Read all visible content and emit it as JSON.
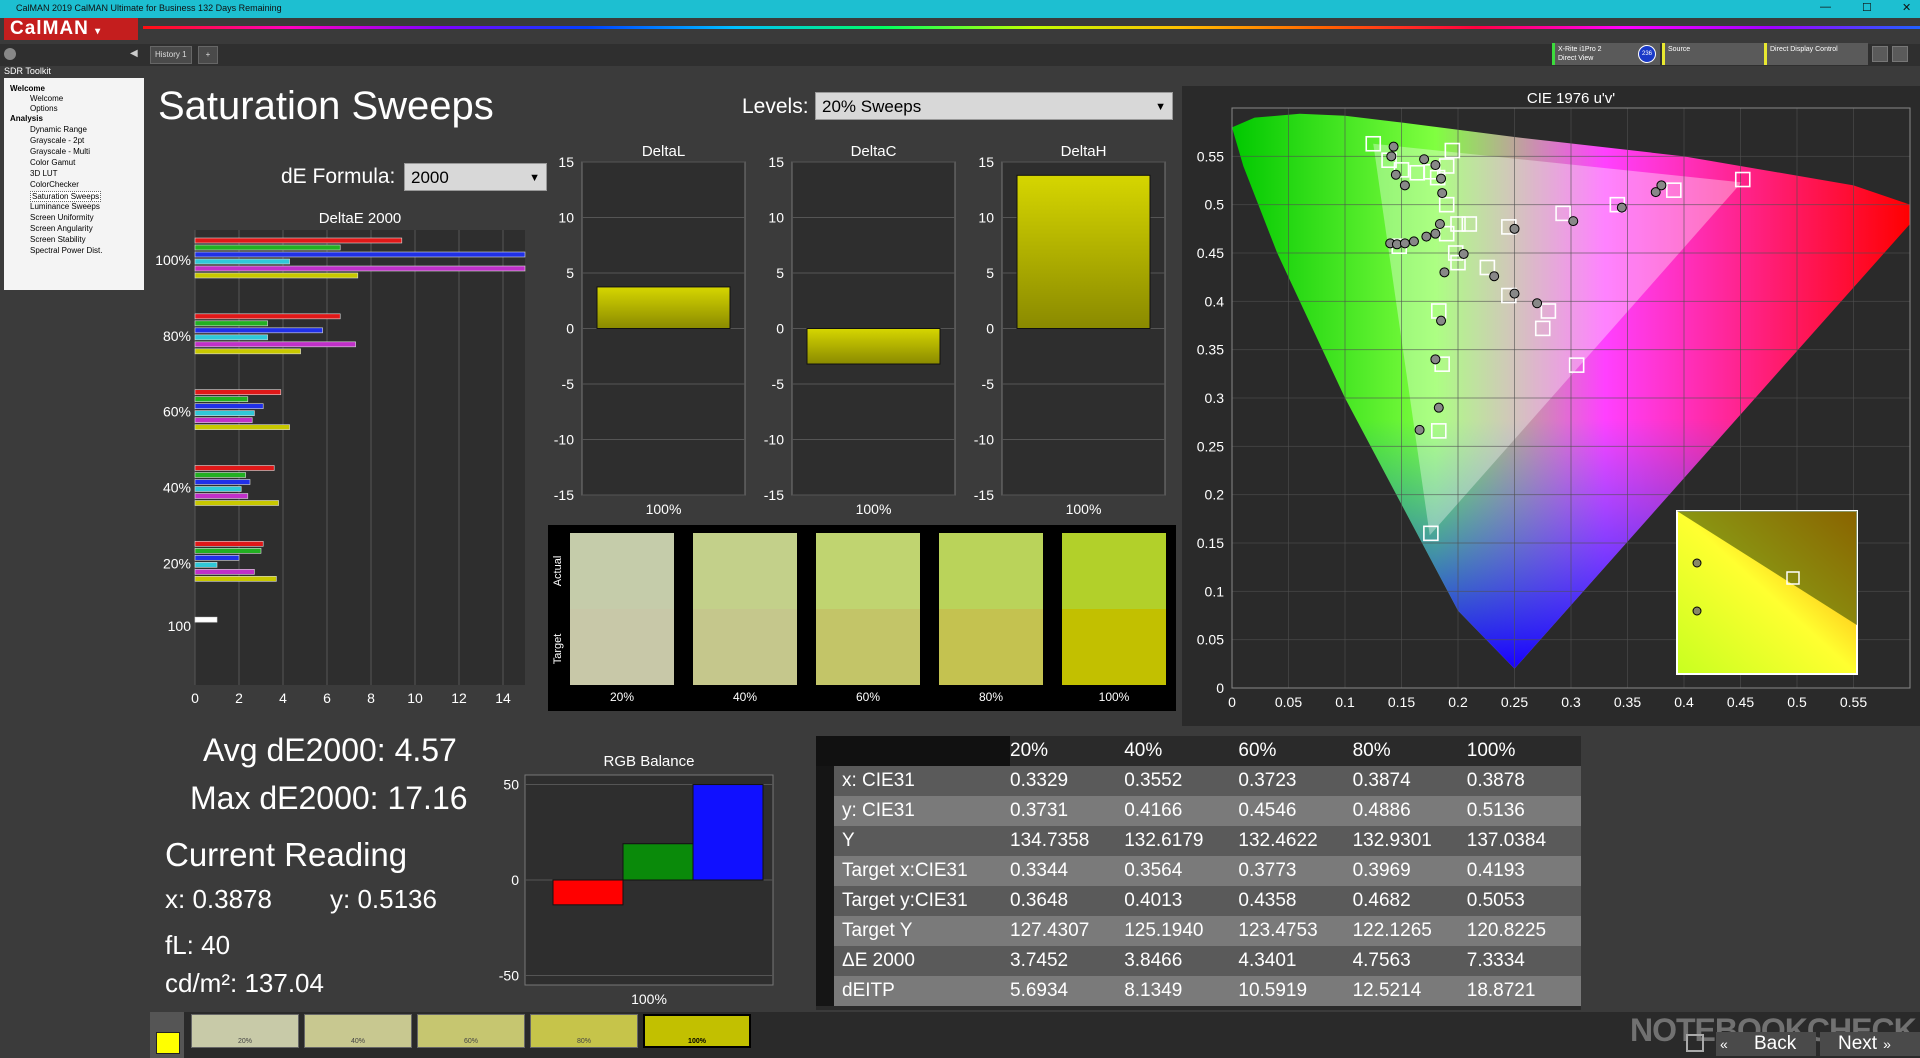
{
  "window": {
    "title": "CalMAN 2019 CalMAN Ultimate for Business 132 Days Remaining",
    "controls": [
      "—",
      "☐",
      "✕"
    ]
  },
  "logo": "CalMAN",
  "tabs": {
    "history": "History 1",
    "add": "+"
  },
  "devices": [
    {
      "line1": "X-Rite i1Pro 2",
      "line2": "Direct View",
      "badge": "236"
    },
    {
      "line1": "Source",
      "line2": ""
    },
    {
      "line1": "Direct Display Control",
      "line2": ""
    }
  ],
  "sidebar": {
    "toolkit": "SDR Toolkit",
    "items": [
      "Welcome",
      "Welcome",
      "Options",
      "Analysis",
      "Dynamic Range",
      "Grayscale - 2pt",
      "Grayscale - Multi",
      "Color Gamut",
      "3D LUT",
      "ColorChecker",
      "Saturation Sweeps",
      "Luminance Sweeps",
      "Screen Uniformity",
      "Screen Angularity",
      "Screen Stability",
      "Spectral Power Dist."
    ]
  },
  "page": {
    "title": "Saturation Sweeps",
    "levels_label": "Levels:",
    "levels_value": "20% Sweeps",
    "de_formula_label": "dE Formula:",
    "de_formula_value": "2000"
  },
  "stats": {
    "avg": "Avg dE2000: 4.57",
    "max": "Max dE2000: 17.16",
    "current_reading": "Current Reading",
    "x": "x: 0.3878",
    "y": "y: 0.5136",
    "fl": "fL: 40",
    "cdm2": "cd/m²: 137.04"
  },
  "colors": {
    "red": "#e01818",
    "green": "#22b022",
    "blue": "#2030e8",
    "cyan": "#30c8d8",
    "magenta": "#c030c8",
    "yellow": "#c8c800",
    "bg": "#3b3b3b",
    "panel": "#2a2a2a"
  },
  "deltae_chart": {
    "title": "DeltaE 2000",
    "type": "bar",
    "xlim": [
      0,
      15
    ],
    "xticks": [
      "0",
      "2",
      "4",
      "6",
      "8",
      "10",
      "12",
      "14"
    ],
    "groups": [
      {
        "label": "100%",
        "values": [
          9.4,
          6.6,
          17.16,
          4.3,
          17.0,
          7.4
        ]
      },
      {
        "label": "80%",
        "values": [
          6.6,
          3.3,
          5.8,
          3.3,
          7.3,
          4.8
        ]
      },
      {
        "label": "60%",
        "values": [
          3.9,
          2.4,
          3.1,
          2.7,
          2.6,
          4.3
        ]
      },
      {
        "label": "40%",
        "values": [
          3.6,
          2.3,
          2.5,
          2.1,
          2.4,
          3.8
        ]
      },
      {
        "label": "20%",
        "values": [
          3.1,
          3.0,
          2.0,
          1.0,
          2.7,
          3.7
        ]
      },
      {
        "label": "100",
        "values": [
          1.0
        ]
      }
    ],
    "series_colors": [
      "#e01818",
      "#22b022",
      "#2030e8",
      "#30c8d8",
      "#c030c8",
      "#c8c800"
    ]
  },
  "delta_charts": [
    {
      "title": "DeltaL",
      "value": 3.7452,
      "xlabel": "100%",
      "yticks": [
        "15",
        "10",
        "5",
        "0",
        "-5",
        "-10",
        "-15"
      ]
    },
    {
      "title": "DeltaC",
      "value": -3.2,
      "xlabel": "100%",
      "yticks": [
        "15",
        "10",
        "5",
        "0",
        "-5",
        "-10",
        "-15"
      ]
    },
    {
      "title": "DeltaH",
      "value": 13.8,
      "xlabel": "100%",
      "yticks": [
        "15",
        "10",
        "5",
        "0",
        "-5",
        "-10",
        "-15"
      ]
    }
  ],
  "swatches": {
    "actual_label": "Actual",
    "target_label": "Target",
    "items": [
      {
        "label": "20%",
        "actual": "#c5ccaa",
        "target": "#c8c8a8"
      },
      {
        "label": "40%",
        "actual": "#c3d08a",
        "target": "#c5c78c"
      },
      {
        "label": "60%",
        "actual": "#c0d470",
        "target": "#c3c568"
      },
      {
        "label": "80%",
        "actual": "#bad35a",
        "target": "#c4c250"
      },
      {
        "label": "100%",
        "actual": "#b2d02a",
        "target": "#c2c000"
      }
    ]
  },
  "rgb_balance": {
    "title": "RGB Balance",
    "xlabel": "100%",
    "yticks": [
      "50",
      "0",
      "-50"
    ],
    "ylim": [
      -55,
      55
    ],
    "values": [
      {
        "name": "R",
        "value": -13,
        "color": "#ff0000"
      },
      {
        "name": "G",
        "value": 19,
        "color": "#0a8a0a"
      },
      {
        "name": "B",
        "value": 50,
        "color": "#1010ff"
      }
    ]
  },
  "cie": {
    "title": "CIE 1976 u'v'",
    "xticks": [
      "0",
      "0.05",
      "0.1",
      "0.15",
      "0.2",
      "0.25",
      "0.3",
      "0.35",
      "0.4",
      "0.45",
      "0.5",
      "0.55"
    ],
    "yticks": [
      "0",
      "0.05",
      "0.1",
      "0.15",
      "0.2",
      "0.25",
      "0.3",
      "0.35",
      "0.4",
      "0.45",
      "0.5",
      "0.55"
    ],
    "targets": [
      [
        0.125,
        0.563
      ],
      [
        0.139,
        0.546
      ],
      [
        0.15,
        0.536
      ],
      [
        0.164,
        0.533
      ],
      [
        0.176,
        0.534
      ],
      [
        0.182,
        0.528
      ],
      [
        0.19,
        0.54
      ],
      [
        0.195,
        0.556
      ],
      [
        0.19,
        0.5
      ],
      [
        0.198,
        0.45
      ],
      [
        0.19,
        0.47
      ],
      [
        0.2,
        0.44
      ],
      [
        0.2,
        0.48
      ],
      [
        0.183,
        0.39
      ],
      [
        0.186,
        0.335
      ],
      [
        0.183,
        0.266
      ],
      [
        0.176,
        0.16
      ],
      [
        0.148,
        0.457
      ],
      [
        0.226,
        0.435
      ],
      [
        0.245,
        0.406
      ],
      [
        0.28,
        0.39
      ],
      [
        0.275,
        0.372
      ],
      [
        0.305,
        0.334
      ],
      [
        0.245,
        0.477
      ],
      [
        0.293,
        0.491
      ],
      [
        0.341,
        0.5
      ],
      [
        0.391,
        0.515
      ],
      [
        0.452,
        0.526
      ],
      [
        0.21,
        0.48
      ]
    ],
    "measured": [
      [
        0.143,
        0.56
      ],
      [
        0.141,
        0.55
      ],
      [
        0.145,
        0.531
      ],
      [
        0.153,
        0.52
      ],
      [
        0.17,
        0.547
      ],
      [
        0.18,
        0.541
      ],
      [
        0.185,
        0.527
      ],
      [
        0.186,
        0.512
      ],
      [
        0.184,
        0.48
      ],
      [
        0.14,
        0.46
      ],
      [
        0.146,
        0.459
      ],
      [
        0.153,
        0.46
      ],
      [
        0.161,
        0.462
      ],
      [
        0.172,
        0.467
      ],
      [
        0.18,
        0.47
      ],
      [
        0.188,
        0.43
      ],
      [
        0.205,
        0.449
      ],
      [
        0.232,
        0.426
      ],
      [
        0.25,
        0.408
      ],
      [
        0.27,
        0.398
      ],
      [
        0.185,
        0.38
      ],
      [
        0.18,
        0.34
      ],
      [
        0.183,
        0.29
      ],
      [
        0.166,
        0.267
      ],
      [
        0.25,
        0.475
      ],
      [
        0.302,
        0.483
      ],
      [
        0.345,
        0.497
      ],
      [
        0.375,
        0.513
      ],
      [
        0.38,
        0.52
      ]
    ]
  },
  "table": {
    "headers": [
      "",
      "20%",
      "40%",
      "60%",
      "80%",
      "100%"
    ],
    "rows": [
      [
        "x: CIE31",
        "0.3329",
        "0.3552",
        "0.3723",
        "0.3874",
        "0.3878"
      ],
      [
        "y: CIE31",
        "0.3731",
        "0.4166",
        "0.4546",
        "0.4886",
        "0.5136"
      ],
      [
        "Y",
        "134.7358",
        "132.6179",
        "132.4622",
        "132.9301",
        "137.0384"
      ],
      [
        "Target x:CIE31",
        "0.3344",
        "0.3564",
        "0.3773",
        "0.3969",
        "0.4193"
      ],
      [
        "Target y:CIE31",
        "0.3648",
        "0.4013",
        "0.4358",
        "0.4682",
        "0.5053"
      ],
      [
        "Target Y",
        "127.4307",
        "125.1940",
        "123.4753",
        "122.1265",
        "120.8225"
      ],
      [
        "ΔE 2000",
        "3.7452",
        "3.8466",
        "4.3401",
        "4.7563",
        "7.3334"
      ],
      [
        "dEITP",
        "5.6934",
        "8.1349",
        "10.5919",
        "12.5214",
        "18.8721"
      ]
    ]
  },
  "bottom": {
    "swatches": [
      {
        "label": "20%",
        "color": "#c8caa8"
      },
      {
        "label": "40%",
        "color": "#c8c890"
      },
      {
        "label": "60%",
        "color": "#c6c670"
      },
      {
        "label": "80%",
        "color": "#c6c44a"
      },
      {
        "label": "100%",
        "color": "#c2c000"
      }
    ],
    "back": "Back",
    "next": "Next",
    "watermark": "NOTEBOOKCHECK"
  }
}
